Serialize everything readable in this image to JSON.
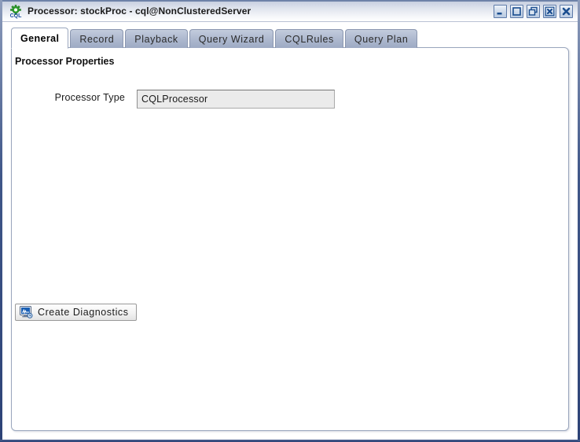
{
  "window": {
    "title": "Processor: stockProc - cql@NonClusteredServer",
    "icon": "cql-gear-icon",
    "controls": [
      {
        "name": "minimize-button",
        "icon": "minimize-icon"
      },
      {
        "name": "maximize-button",
        "icon": "maximize-icon"
      },
      {
        "name": "restore-button",
        "icon": "restore-icon"
      },
      {
        "name": "close-frame-button",
        "icon": "close-box-icon"
      },
      {
        "name": "close-button",
        "icon": "close-icon"
      }
    ]
  },
  "tabs": [
    {
      "label": "General",
      "active": true
    },
    {
      "label": "Record",
      "active": false
    },
    {
      "label": "Playback",
      "active": false
    },
    {
      "label": "Query Wizard",
      "active": false
    },
    {
      "label": "CQLRules",
      "active": false
    },
    {
      "label": "Query Plan",
      "active": false
    }
  ],
  "general_panel": {
    "section_title": "Processor Properties",
    "processor_type": {
      "label": "Processor Type",
      "value": "CQLProcessor",
      "placeholder": "",
      "readonly": true
    },
    "diagnostics_button": {
      "label": "Create Diagnostics",
      "icon": "monitor-chart-icon"
    }
  },
  "colors": {
    "window_border": "#2c4276",
    "titlebar_top": "#c8d0e0",
    "titlebar_bottom": "#ffffff",
    "tab_inactive": "#aeb9cf",
    "tab_active": "#ffffff",
    "panel_border": "#9aa6bd",
    "field_disabled_bg": "#ebebeb",
    "icon_accent": "#1a5fb4",
    "icon_green": "#2f9e2f"
  }
}
